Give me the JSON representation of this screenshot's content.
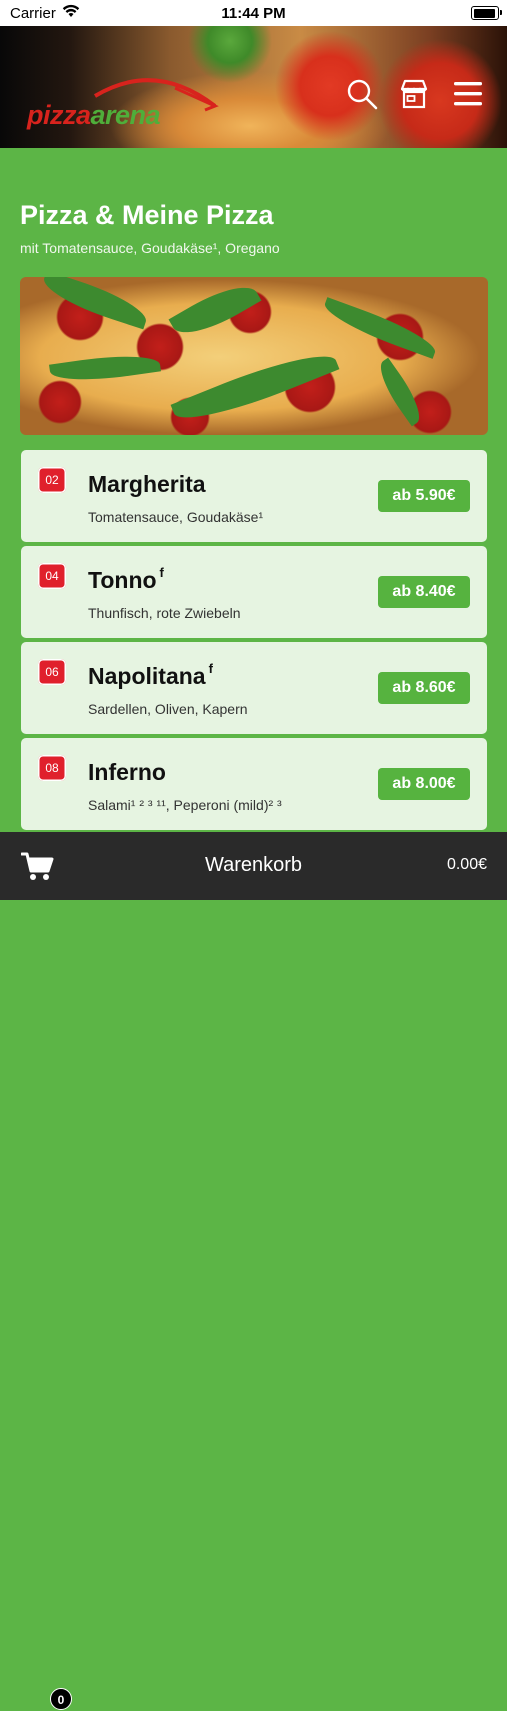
{
  "status_bar": {
    "carrier": "Carrier",
    "time": "11:44 PM"
  },
  "header": {
    "logo_text_left": "pizza",
    "logo_text_right": "arena",
    "icons": [
      "search-icon",
      "store-icon",
      "menu-icon"
    ]
  },
  "category": {
    "title": "Pizza & Meine Pizza",
    "subtitle": "mit Tomatensauce, Goudakäse¹, Oregano"
  },
  "items": [
    {
      "number": "02",
      "name": "Margherita",
      "marker": "",
      "description": "Tomatensauce, Goudakäse¹",
      "price": "ab 5.90€"
    },
    {
      "number": "04",
      "name": "Tonno",
      "marker": "f",
      "description": "Thunfisch, rote Zwiebeln",
      "price": "ab 8.40€"
    },
    {
      "number": "06",
      "name": "Napolitana",
      "marker": "f",
      "description": "Sardellen, Oliven, Kapern",
      "price": "ab 8.60€"
    },
    {
      "number": "08",
      "name": "Inferno",
      "marker": "",
      "description": "Salami¹ ² ³ ¹¹, Peperoni (mild)² ³",
      "price": "ab 8.00€"
    }
  ],
  "cart": {
    "count": "0",
    "label": "Warenkorb",
    "total": "0.00€"
  },
  "colors": {
    "brand_green": "#5cb546",
    "accent_red": "#e0202c",
    "card_bg": "#e6f4e1",
    "bar_dark": "#2a2a2a"
  }
}
